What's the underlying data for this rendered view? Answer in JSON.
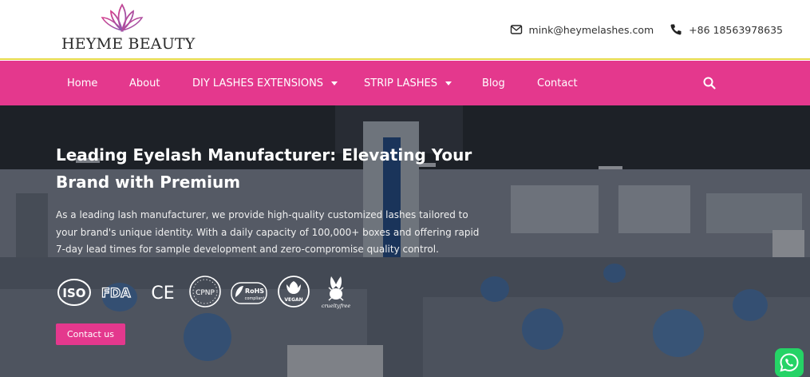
{
  "header": {
    "brand_name": "HEYME BEAUTY",
    "email": "mink@heymelashes.com",
    "phone": "+86 18563978635",
    "icons": [
      "lotus-logo-icon",
      "envelope-icon",
      "phone-icon"
    ]
  },
  "nav": {
    "items": [
      {
        "label": "Home"
      },
      {
        "label": "About"
      },
      {
        "label": "DIY LASHES EXTENSIONS"
      },
      {
        "label": "STRIP LASHES"
      },
      {
        "label": "Blog"
      },
      {
        "label": "Contact"
      }
    ],
    "search_icon": "search-icon"
  },
  "hero": {
    "title": "Leading Eyelash Manufacturer: Elevating Your Brand with Premium",
    "description": "As a leading lash manufacturer, we provide high-quality customized lashes tailored to your brand's unique identity. With a daily capacity of 100,000+ boxes and offering rapid 7-day lead times for sample development and zero-compromise quality control.",
    "certifications": {
      "iso": "ISO",
      "fda": "FDA",
      "ce": "CE",
      "cpnp": "CPNP",
      "rohs": "RoHS",
      "rohs_sub": "compliant",
      "vegan": "VEGAN",
      "cruelty_free": "crueltyfree"
    },
    "cta_label": "Contact us"
  },
  "widgets": {
    "whatsapp_icon": "whatsapp-icon"
  },
  "colors": {
    "accent": "#e4388d",
    "header_border": "#e8d84a",
    "whatsapp": "#25d366"
  }
}
